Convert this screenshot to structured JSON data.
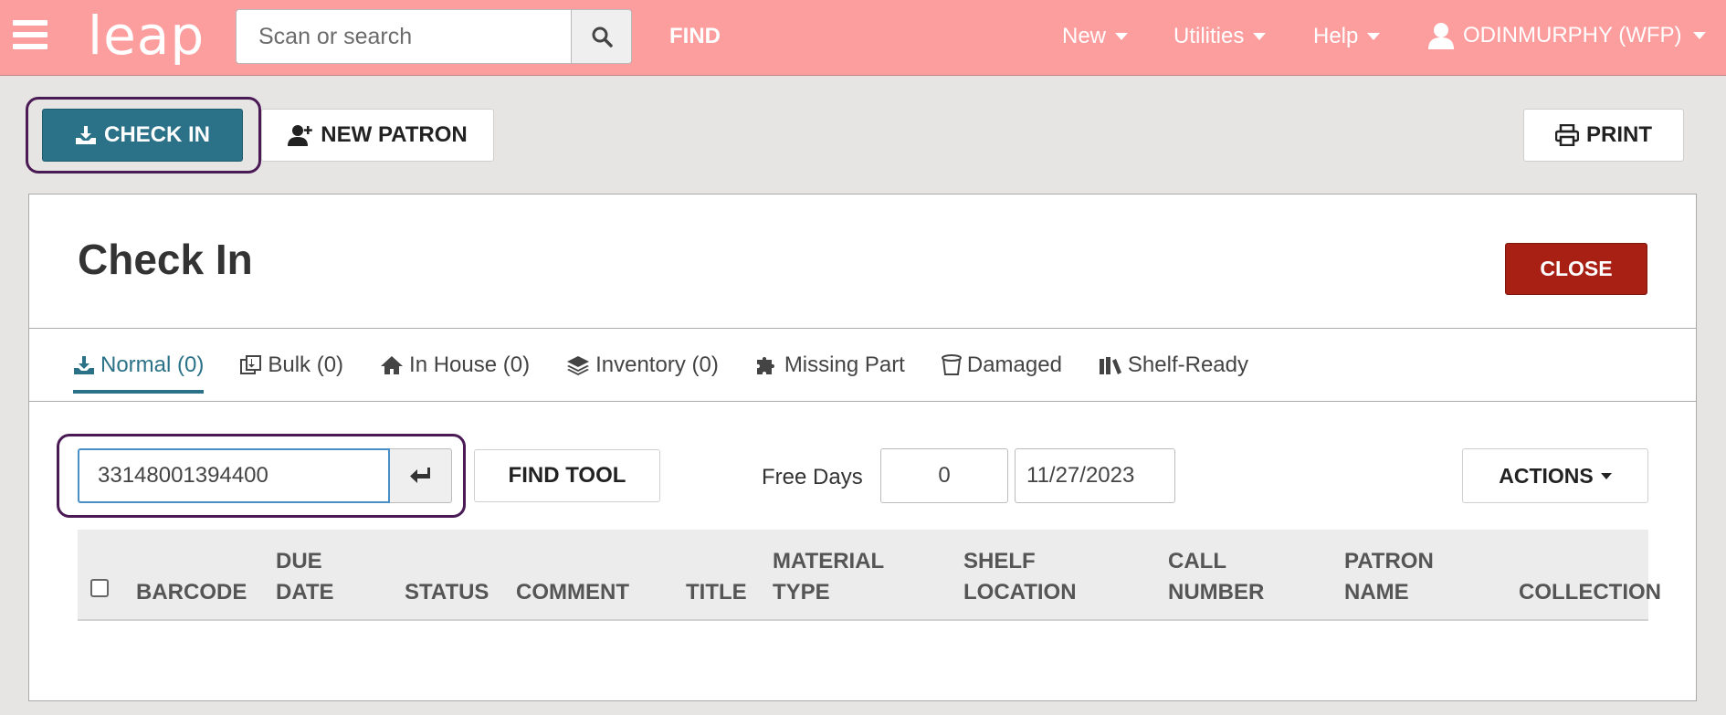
{
  "topbar": {
    "logo": "leap",
    "search_placeholder": "Scan or search",
    "find_label": "FIND",
    "menus": [
      "New",
      "Utilities",
      "Help"
    ],
    "user": "ODINMURPHY (WFP)"
  },
  "actions": {
    "check_in": "CHECK IN",
    "new_patron": "NEW PATRON",
    "print": "PRINT"
  },
  "panel": {
    "title": "Check In",
    "close": "CLOSE",
    "tabs": [
      {
        "label": "Normal (0)",
        "icon": "download-icon",
        "active": true
      },
      {
        "label": "Bulk (0)",
        "icon": "bulk-icon",
        "active": false
      },
      {
        "label": "In House (0)",
        "icon": "home-icon",
        "active": false
      },
      {
        "label": "Inventory (0)",
        "icon": "layers-icon",
        "active": false
      },
      {
        "label": "Missing Part",
        "icon": "puzzle-icon",
        "active": false
      },
      {
        "label": "Damaged",
        "icon": "trash-icon",
        "active": false
      },
      {
        "label": "Shelf-Ready",
        "icon": "books-icon",
        "active": false
      }
    ],
    "barcode_value": "33148001394400",
    "find_tool": "FIND TOOL",
    "free_days_label": "Free Days",
    "free_days_value": "0",
    "date_value": "11/27/2023",
    "actions_label": "ACTIONS",
    "columns": [
      "BARCODE",
      "DUE DATE",
      "STATUS",
      "COMMENT",
      "TITLE",
      "MATERIAL TYPE",
      "SHELF LOCATION",
      "CALL NUMBER",
      "PATRON NAME",
      "COLLECTION"
    ]
  },
  "colors": {
    "topbar": "#fc9d9e",
    "primary": "#2b7288",
    "danger": "#a81f14",
    "highlight": "#4a1a55"
  }
}
